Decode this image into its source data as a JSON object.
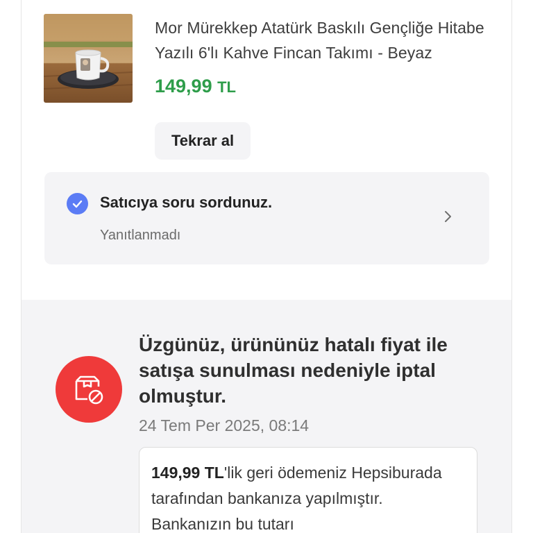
{
  "product": {
    "image_alt": "Atatürk baskılı kahve fincanı",
    "title": "Mor Mürekkep Atatürk Baskılı Gençliğe Hitabe Yazılı 6'lı Kahve Fincan Takımı - Beyaz",
    "price_amount": "149,99",
    "price_currency": "TL",
    "price_color": "#2e9d4a",
    "reorder_label": "Tekrar al"
  },
  "question": {
    "title": "Satıcıya soru sordunuz.",
    "status": "Yanıtlanmadı",
    "check_icon": "check-circle-icon",
    "chevron_icon": "chevron-right-icon",
    "accent_color": "#5b7cf5"
  },
  "cancellation": {
    "title": "Üzgünüz, ürününüz hatalı fiyat ile satışa sunulması nedeniyle iptal olmuştur.",
    "date": "24 Tem Per 2025, 08:14",
    "badge_icon": "box-cancel-icon",
    "badge_color": "#ef3a3a",
    "refund_amount": "149,99 TL",
    "refund_text": "'lik geri ödemeniz Hepsiburada tarafından bankanıza yapılmıştır. Bankanızın bu tutarı"
  }
}
